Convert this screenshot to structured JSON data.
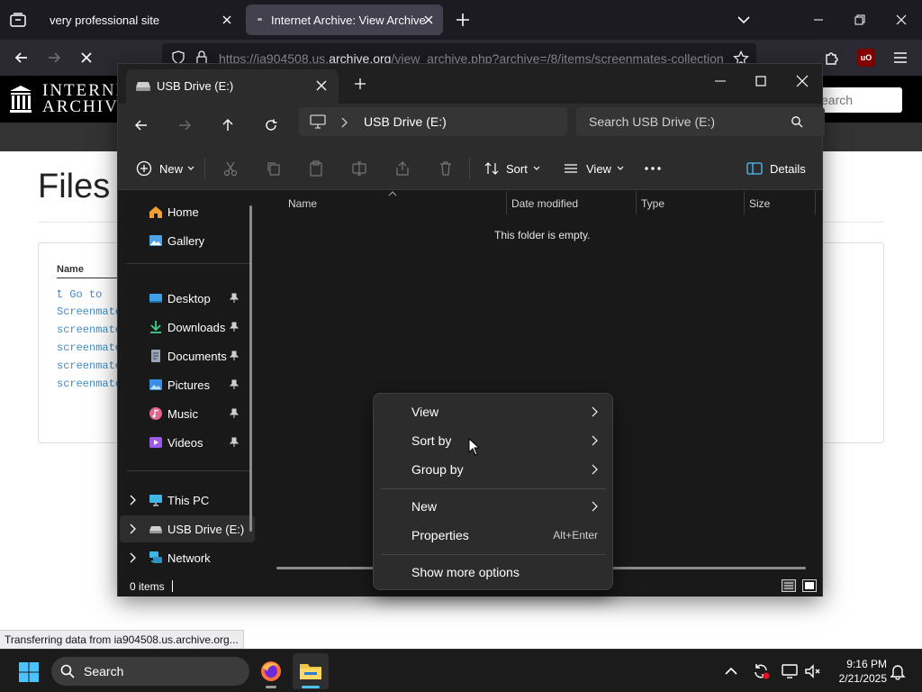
{
  "browser": {
    "tabs": [
      {
        "label": "very professional site",
        "active": false
      },
      {
        "label": "Internet Archive: View Archive",
        "active": true
      }
    ],
    "url": {
      "prefix": "https://ia904508.us.",
      "domain": "archive.org",
      "path": "/view_archive.php?archive=/8/items/screenmates-collection-"
    },
    "status_text": "Transferring data from ia904508.us.archive.org..."
  },
  "webpage": {
    "logo_line1": "INTERNE",
    "logo_line2": "ARCHIVE",
    "search_placeholder": "earch",
    "title": "Files",
    "column_name": "Name",
    "rows": [
      "Go to",
      "Screenmate",
      "screenmate",
      "screenmate",
      "screenmate",
      "screenmate"
    ]
  },
  "explorer": {
    "tab_title": "USB Drive (E:)",
    "address": "USB Drive (E:)",
    "search_placeholder": "Search USB Drive (E:)",
    "toolbar": {
      "new": "New",
      "sort": "Sort",
      "view": "View",
      "details": "Details"
    },
    "sidebar": {
      "quick": [
        {
          "label": "Home",
          "icon": "home-icon"
        },
        {
          "label": "Gallery",
          "icon": "gallery-icon"
        }
      ],
      "pinned": [
        {
          "label": "Desktop",
          "icon": "desktop-icon"
        },
        {
          "label": "Downloads",
          "icon": "downloads-icon"
        },
        {
          "label": "Documents",
          "icon": "documents-icon"
        },
        {
          "label": "Pictures",
          "icon": "pictures-icon"
        },
        {
          "label": "Music",
          "icon": "music-icon"
        },
        {
          "label": "Videos",
          "icon": "videos-icon"
        }
      ],
      "locations": [
        {
          "label": "This PC",
          "icon": "pc-icon"
        },
        {
          "label": "USB Drive (E:)",
          "icon": "drive-icon",
          "selected": true
        },
        {
          "label": "Network",
          "icon": "network-icon"
        }
      ]
    },
    "columns": [
      "Name",
      "Date modified",
      "Type",
      "Size"
    ],
    "empty_message": "This folder is empty.",
    "status": "0 items"
  },
  "context_menu": {
    "items": [
      {
        "label": "View",
        "submenu": true
      },
      {
        "label": "Sort by",
        "submenu": true
      },
      {
        "label": "Group by",
        "submenu": true
      },
      {
        "label": "New",
        "submenu": true
      },
      {
        "label": "Properties",
        "shortcut": "Alt+Enter"
      },
      {
        "label": "Show more options"
      }
    ]
  },
  "taskbar": {
    "search_label": "Search",
    "time": "9:16 PM",
    "date": "2/21/2025"
  },
  "colors": {
    "accent": "#4cc2ff",
    "browser_bg": "#1c1b22",
    "explorer_bg": "#191919",
    "link": "#428bca"
  }
}
